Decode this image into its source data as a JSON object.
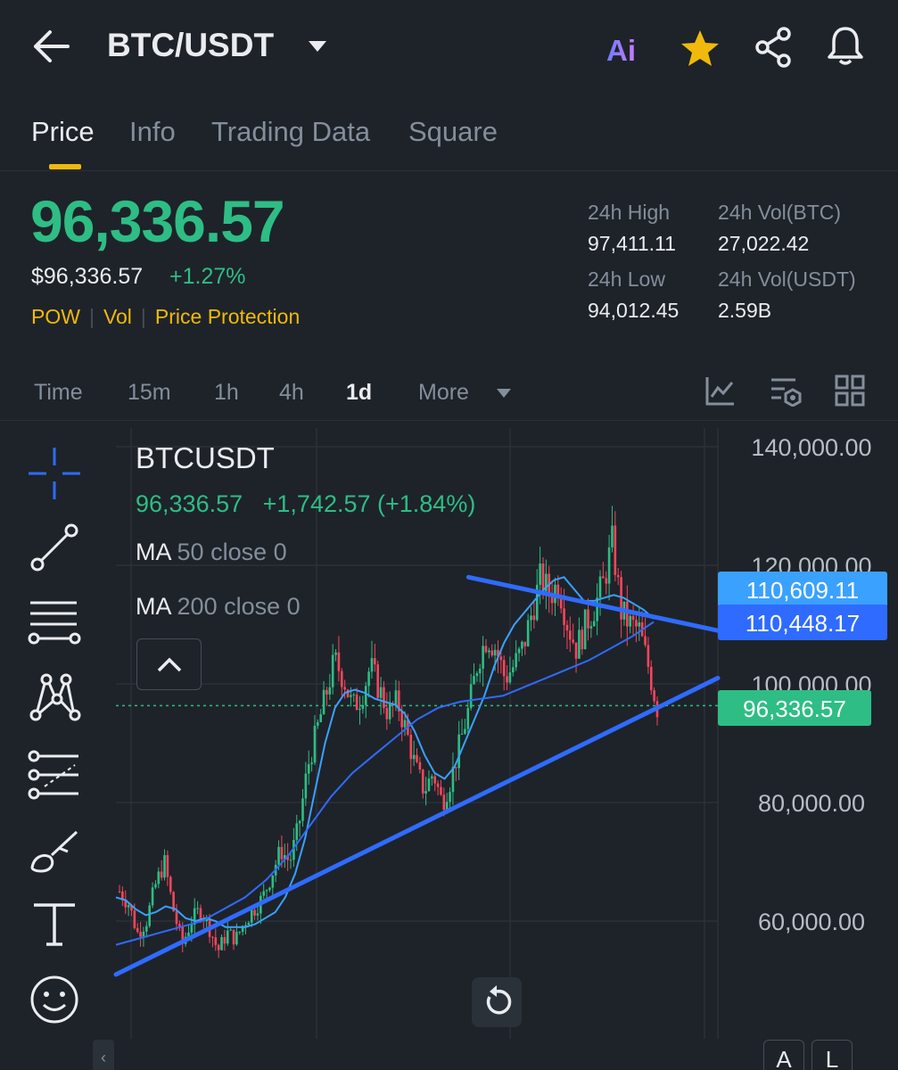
{
  "header": {
    "pair": "BTC/USDT",
    "ai_label": "Ai"
  },
  "tabs": [
    {
      "label": "Price",
      "active": true
    },
    {
      "label": "Info",
      "active": false
    },
    {
      "label": "Trading Data",
      "active": false
    },
    {
      "label": "Square",
      "active": false
    }
  ],
  "price": {
    "last": "96,336.57",
    "usd": "$96,336.57",
    "change_pct": "+1.27%",
    "tags": [
      "POW",
      "Vol",
      "Price Protection"
    ]
  },
  "stats": {
    "high_label": "24h High",
    "high_value": "97,411.11",
    "low_label": "24h Low",
    "low_value": "94,012.45",
    "vol_btc_label": "24h Vol(BTC)",
    "vol_btc_value": "27,022.42",
    "vol_usdt_label": "24h Vol(USDT)",
    "vol_usdt_value": "2.59B"
  },
  "timeframes": {
    "items": [
      "Time",
      "15m",
      "1h",
      "4h",
      "1d",
      "More"
    ],
    "active": "1d"
  },
  "tool_icons": [
    "crosshair-icon",
    "trend-line-icon",
    "horizontal-lines-icon",
    "pattern-icon",
    "fib-icon",
    "brush-icon",
    "text-icon",
    "emoji-icon"
  ],
  "chart": {
    "symbol": "BTCUSDT",
    "ohlc_price": "96,336.57",
    "ohlc_change": "+1,742.57 (+1.84%)",
    "ma1_label": "MA",
    "ma1_params": "50 close 0",
    "ma2_label": "MA",
    "ma2_params": "200 close 0",
    "tag_upper": "110,609.11",
    "tag_lower": "110,448.17",
    "tag_last": "96,336.57",
    "a_label": "A",
    "l_label": "L",
    "scroll_glyph": "‹"
  },
  "colors": {
    "up": "#2ebd85",
    "down": "#f6465d",
    "accent": "#f0b90b",
    "trend": "#2f6bff",
    "ma50": "#3aa1ff",
    "ma200": "#2f6bff"
  },
  "chart_data": {
    "type": "candlestick",
    "title": "BTCUSDT",
    "ylim": [
      50000,
      140000
    ],
    "y_ticks": [
      140000,
      120000,
      100000,
      80000,
      60000
    ],
    "y_tick_labels": [
      "140,000.00",
      "120,000.00",
      "100,000.00",
      "80,000.00",
      "60,000.00"
    ],
    "last_price": 96336.57,
    "close_series": [
      65000,
      63000,
      58000,
      60000,
      66000,
      70000,
      62000,
      56000,
      60000,
      62000,
      59000,
      55000,
      58000,
      57000,
      60000,
      62000,
      64000,
      68000,
      72000,
      70000,
      76000,
      86000,
      92000,
      98000,
      104000,
      101000,
      96000,
      98000,
      103000,
      99000,
      95000,
      97000,
      92000,
      86000,
      82000,
      85000,
      80000,
      84000,
      90000,
      96000,
      104000,
      108000,
      106000,
      101000,
      103000,
      106000,
      112000,
      118000,
      115000,
      117000,
      110000,
      106000,
      110000,
      113000,
      117000,
      124000,
      112000,
      110000,
      109000,
      103000,
      96000
    ],
    "ma50": [
      64000,
      63500,
      62000,
      61000,
      61500,
      62500,
      62000,
      60500,
      60000,
      60500,
      60000,
      59000,
      59000,
      59000,
      59500,
      60500,
      61500,
      64000,
      68000,
      74000,
      82000,
      90000,
      96000,
      98500,
      99000,
      98500,
      97500,
      97000,
      96500,
      95000,
      92000,
      88000,
      85000,
      84000,
      86000,
      90000,
      94000,
      98000,
      103000,
      107000,
      110000,
      112000,
      114000,
      116000,
      117500,
      118000,
      116000,
      114000,
      114000,
      114500,
      115000,
      114500,
      113500,
      112500,
      111000
    ],
    "ma200": [
      56000,
      57000,
      58000,
      59000,
      60000,
      62000,
      64000,
      67000,
      71000,
      76000,
      81000,
      85000,
      88000,
      91000,
      94000,
      96000,
      97000,
      97500,
      98000,
      99500,
      101000,
      102500,
      104000,
      106000,
      108000,
      110448
    ],
    "trendlines": [
      {
        "name": "support",
        "from": [
          0,
          51000
        ],
        "to": [
          70,
          101000
        ]
      },
      {
        "name": "resistance",
        "from": [
          41,
          118000
        ],
        "to": [
          70,
          109000
        ]
      }
    ]
  }
}
